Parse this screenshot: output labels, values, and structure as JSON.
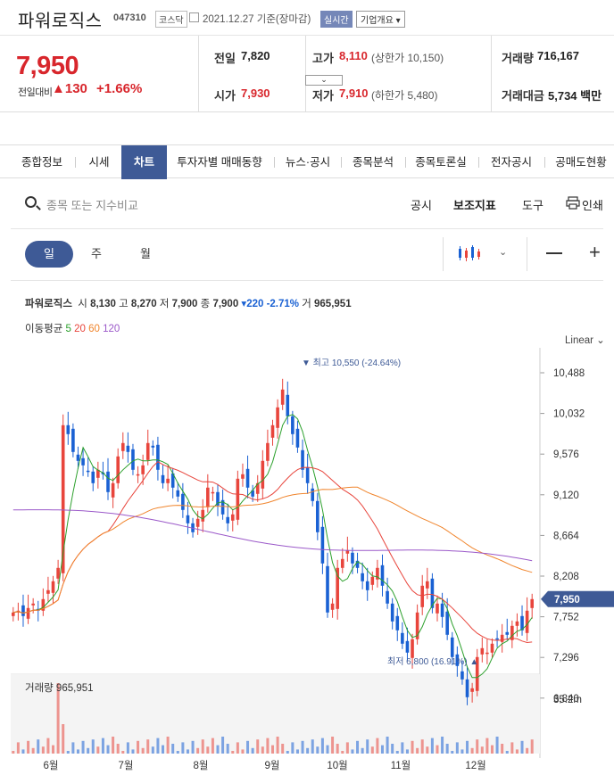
{
  "header": {
    "name": "파워로직스",
    "code": "047310",
    "market": "코스닥",
    "date": "2021.12.27 기준(장마감)",
    "live": "실시간",
    "company_info": "기업개요 ▾"
  },
  "price": {
    "current": "7,950",
    "change_label": "전일대비",
    "change_value": "▲130",
    "change_pct": "+1.66%"
  },
  "quote": {
    "prev_label": "전일",
    "prev": "7,820",
    "high_label": "고가",
    "high": "8,110",
    "upper_limit": "(상한가 10,150)",
    "volume_label": "거래량",
    "volume": "716,167",
    "open_label": "시가",
    "open": "7,930",
    "low_label": "저가",
    "low": "7,910",
    "lower_limit": "(하한가 5,480)",
    "amount_label": "거래대금",
    "amount": "5,734 백만"
  },
  "tabs": [
    "종합정보",
    "시세",
    "차트",
    "투자자별 매매동향",
    "뉴스·공시",
    "종목분석",
    "종목토론실",
    "전자공시",
    "공매도현황"
  ],
  "search": {
    "placeholder": "종목 또는 지수비교"
  },
  "tools": {
    "notice": "공시",
    "indicator": "보조지표",
    "tool": "도구",
    "print": "인쇄"
  },
  "periods": [
    "일",
    "주",
    "월"
  ],
  "legend": {
    "name": "파워로직스",
    "open_label": "시",
    "open": "8,130",
    "high_label": "고",
    "high": "8,270",
    "low_label": "저",
    "low": "7,900",
    "close_label": "종",
    "close": "7,900",
    "change": "▾220 -2.71%",
    "vol_label": "거",
    "vol": "965,951",
    "ma_label": "이동평균",
    "ma5": "5",
    "ma20": "20",
    "ma60": "60",
    "ma120": "120"
  },
  "scale_mode": "Linear",
  "volume_label": "거래량 965,951",
  "chart_data": {
    "type": "candlestick",
    "y_ticks": [
      "10,488",
      "10,032",
      "9,576",
      "9,120",
      "8,664",
      "8,208",
      "7,752",
      "7,296",
      "6,840"
    ],
    "x_ticks": [
      "6월",
      "7월",
      "8월",
      "9월",
      "10월",
      "11월",
      "12월"
    ],
    "current_tag": "7,950",
    "max_annotation": "▼ 최고 10,550 (-24.64%)",
    "min_annotation": "최저 6,800 (16.91%) ▲",
    "volume_max_tick": "35.2m",
    "colors": {
      "up": "#e8453c",
      "down": "#1a61d3",
      "ma5": "#2ca02c",
      "ma20": "#e8453c",
      "ma60": "#f0852d",
      "ma120": "#9b59c9"
    },
    "close_path": [
      7800,
      7820,
      7760,
      7850,
      7900,
      7820,
      7950,
      8050,
      8150,
      8300,
      9900,
      9800,
      9600,
      9500,
      9450,
      9380,
      9250,
      9400,
      9350,
      9150,
      9250,
      9550,
      9700,
      9600,
      9400,
      9350,
      9450,
      9700,
      9650,
      9400,
      9250,
      9300,
      9200,
      9100,
      8950,
      8800,
      8700,
      8850,
      8950,
      9200,
      9150,
      9000,
      8900,
      8800,
      8900,
      9300,
      9350,
      9200,
      9100,
      9250,
      9500,
      9700,
      9900,
      10100,
      10300,
      10000,
      9800,
      9650,
      9400,
      9250,
      9050,
      8700,
      8350,
      7800,
      7900,
      8300,
      8400,
      8500,
      8350,
      8300,
      8150,
      8050,
      8200,
      8300,
      8100,
      7900,
      7700,
      7600,
      7450,
      7350,
      7500,
      7800,
      8100,
      8150,
      7850,
      7900,
      7750,
      7550,
      7300,
      7200,
      7050,
      6850,
      6950,
      7300,
      7400,
      7350,
      7450,
      7500,
      7550,
      7550,
      7650,
      7700,
      7600,
      7820,
      7950
    ]
  }
}
